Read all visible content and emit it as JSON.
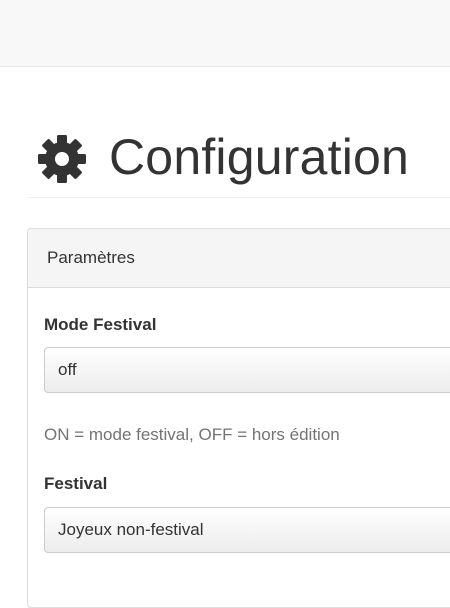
{
  "header": {
    "title": "Configuration",
    "icon": "gear-icon"
  },
  "panel": {
    "heading": "Paramètres",
    "fields": [
      {
        "label": "Mode Festival",
        "value": "off",
        "help": "ON = mode festival, OFF = hors édition"
      },
      {
        "label": "Festival",
        "value": "Joyeux non-festival"
      }
    ]
  }
}
